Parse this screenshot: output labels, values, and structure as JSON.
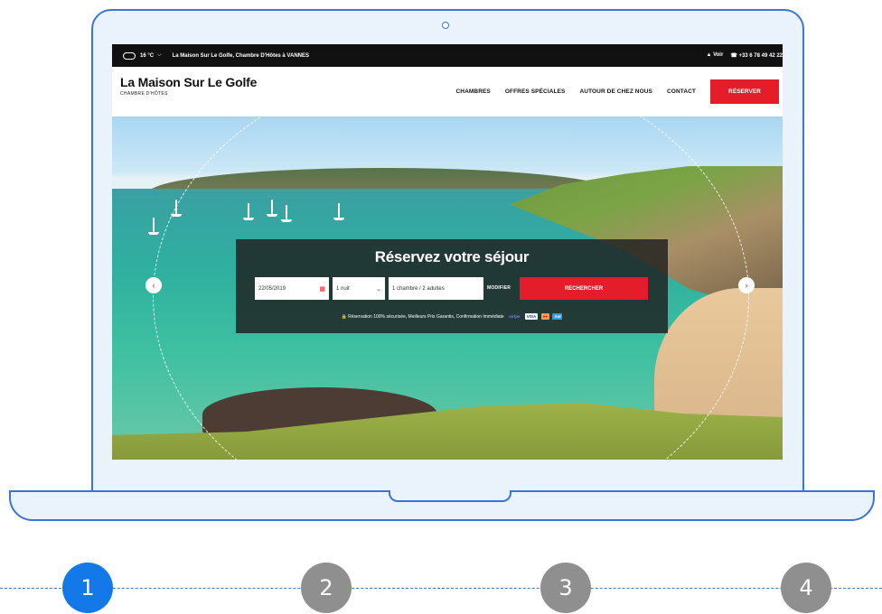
{
  "topbar": {
    "weather_icon": "cloud-icon",
    "temperature": "16 °C",
    "chevron": "⌵",
    "site_label": "La Maison Sur Le Golfe, Chambre D'Hôtes à VANNES",
    "map_label": "▲ Voir",
    "phone": "☎ +33 6 78 49 42 22"
  },
  "header": {
    "brand_title": "La Maison Sur Le Golfe",
    "brand_subtitle": "CHAMBRE D'HÔTES",
    "nav": [
      "CHAMBRES",
      "OFFRES SPÉCIALES",
      "AUTOUR DE CHEZ NOUS",
      "CONTACT"
    ],
    "reserve_label": "RÉSERVER"
  },
  "booking": {
    "title": "Réservez votre séjour",
    "date_value": "22/05/2019",
    "nights_value": "1 nuit",
    "rooms_value": "1 chambre / 2 adultes",
    "modify_label": "MODIFIER",
    "search_label": "RECHERCHER",
    "secure_text": "🔒 Réservation 100% sécurisée, Meilleurs Prix Garantis, Confirmation Immédiate",
    "payment_logos": [
      "stripe",
      "VISA",
      "●●",
      "AM"
    ]
  },
  "carousel": {
    "prev_arrow": "‹",
    "next_arrow": "›"
  },
  "steps": [
    "1",
    "2",
    "3",
    "4"
  ],
  "colors": {
    "brand_red": "#e31d2a",
    "frame_blue": "#3b74d6",
    "step_active": "#1479e8",
    "step_inactive": "#8f8f8f"
  }
}
